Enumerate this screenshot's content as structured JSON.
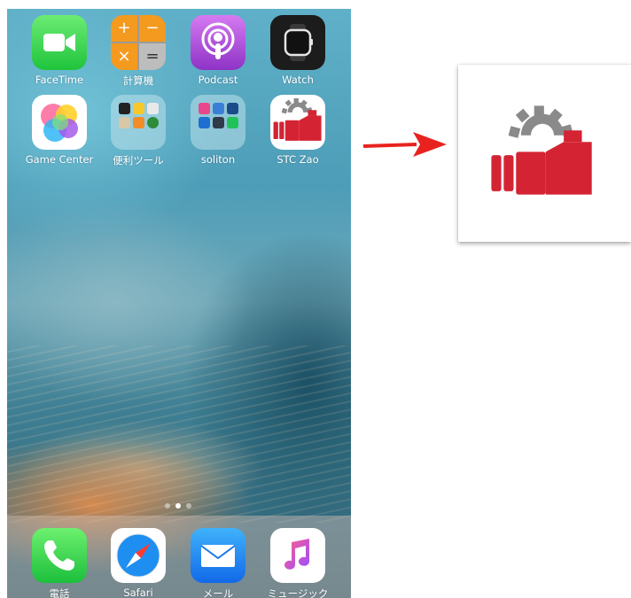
{
  "home": {
    "apps": [
      {
        "label": "FaceTime",
        "icon": "facetime-icon"
      },
      {
        "label": "計算機",
        "icon": "calculator-icon"
      },
      {
        "label": "Podcast",
        "icon": "podcast-icon"
      },
      {
        "label": "Watch",
        "icon": "watch-icon"
      },
      {
        "label": "Game Center",
        "icon": "game-center-icon"
      },
      {
        "label": "便利ツール",
        "icon": "folder-icon"
      },
      {
        "label": "soliton",
        "icon": "folder-icon"
      },
      {
        "label": "STC Zao",
        "icon": "stc-zao-icon"
      }
    ],
    "calculator_keys": [
      "+",
      "−",
      "×",
      "="
    ],
    "page_count": 3,
    "current_page": 2
  },
  "dock": {
    "apps": [
      {
        "label": "電話",
        "icon": "phone-icon"
      },
      {
        "label": "Safari",
        "icon": "safari-icon"
      },
      {
        "label": "メール",
        "icon": "mail-icon"
      },
      {
        "label": "ミュージック",
        "icon": "music-icon"
      }
    ]
  },
  "callout": {
    "arrow_color": "#e8231f",
    "icon": "stc-zao-icon",
    "brand_red": "#d42433",
    "gear_gray": "#8a8a8a"
  }
}
